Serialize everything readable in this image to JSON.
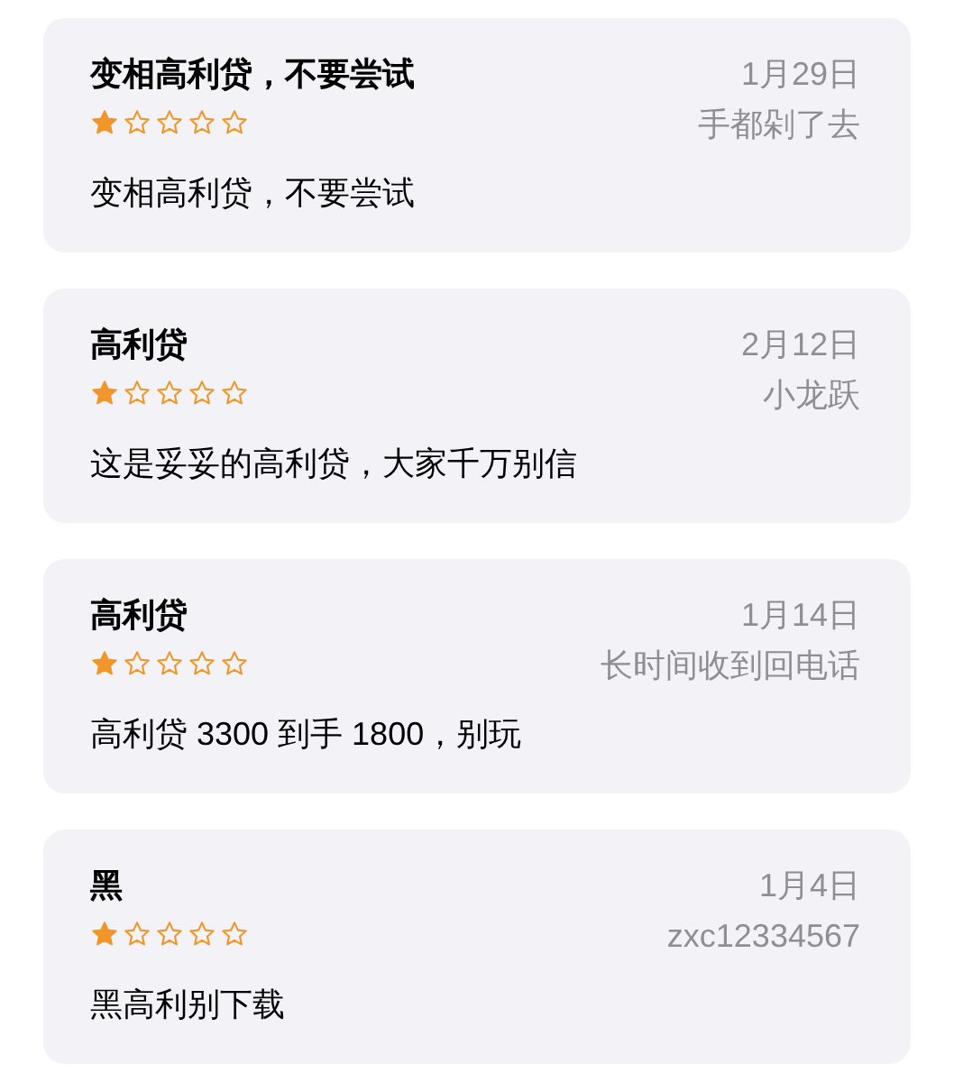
{
  "reviews": [
    {
      "title": "变相高利贷，不要尝试",
      "stars": 1,
      "date": "1月29日",
      "author": "手都剁了去",
      "body": "变相高利贷，不要尝试"
    },
    {
      "title": "高利贷",
      "stars": 1,
      "date": "2月12日",
      "author": "小龙跃",
      "body": "这是妥妥的高利贷，大家千万别信"
    },
    {
      "title": "高利贷",
      "stars": 1,
      "date": "1月14日",
      "author": "长时间收到回电话",
      "body": "高利贷 3300 到手 1800，别玩"
    },
    {
      "title": "黑",
      "stars": 1,
      "date": "1月4日",
      "author": "zxc12334567",
      "body": "黑高利别下载"
    }
  ]
}
